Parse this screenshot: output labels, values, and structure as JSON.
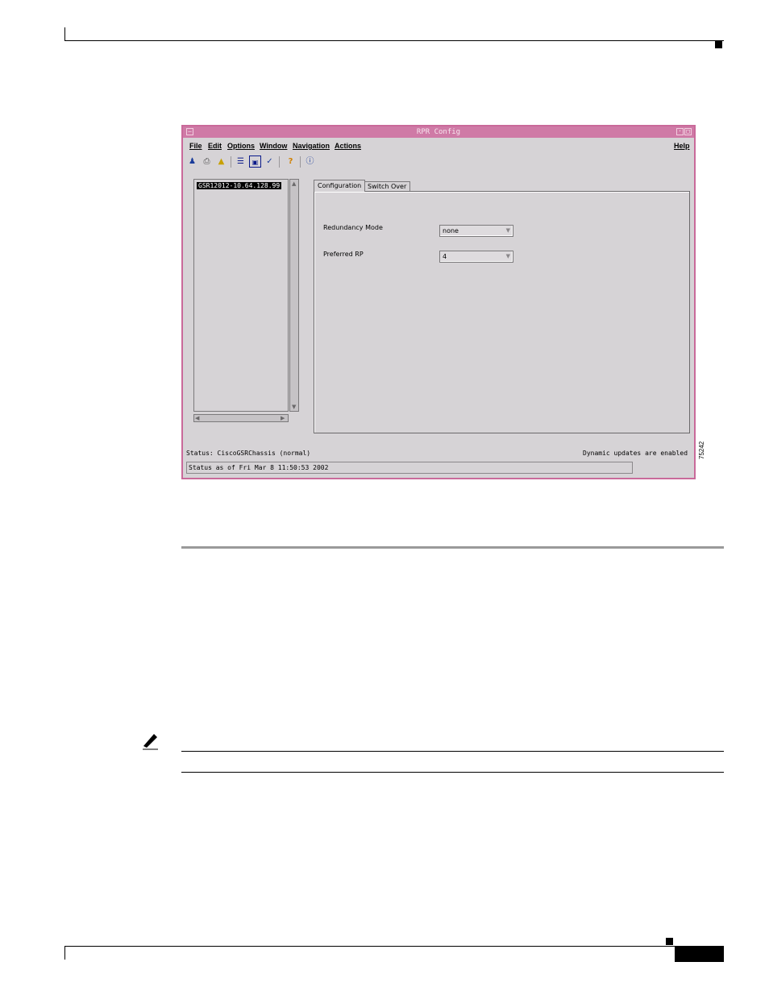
{
  "window": {
    "title": "RPR Config",
    "menu": [
      "File",
      "Edit",
      "Options",
      "Window",
      "Navigation",
      "Actions"
    ],
    "help_menu": "Help",
    "toolbar_icons": [
      "user-icon",
      "printer-icon",
      "open-folder-icon",
      "list-icon",
      "properties-icon",
      "check-icon",
      "help-icon",
      "info-icon"
    ]
  },
  "tree": {
    "selected_item": "GSR12012-10.64.128.99"
  },
  "tabs": [
    {
      "label": "Configuration",
      "active": true
    },
    {
      "label": "Switch Over",
      "active": false
    }
  ],
  "form": {
    "redundancy_mode_label": "Redundancy Mode",
    "redundancy_mode_value": "none",
    "preferred_rp_label": "Preferred RP",
    "preferred_rp_value": "4"
  },
  "status": {
    "status_text": "Status: CiscoGSRChassis (normal)",
    "updates_text": "Dynamic updates are enabled",
    "timestamp_text": "Status as of Fri Mar  8 11:50:53 2002"
  },
  "figure_id": "75242",
  "colors": {
    "titlebar": "#cf7aa6",
    "window_bg": "#d6d3d6"
  }
}
